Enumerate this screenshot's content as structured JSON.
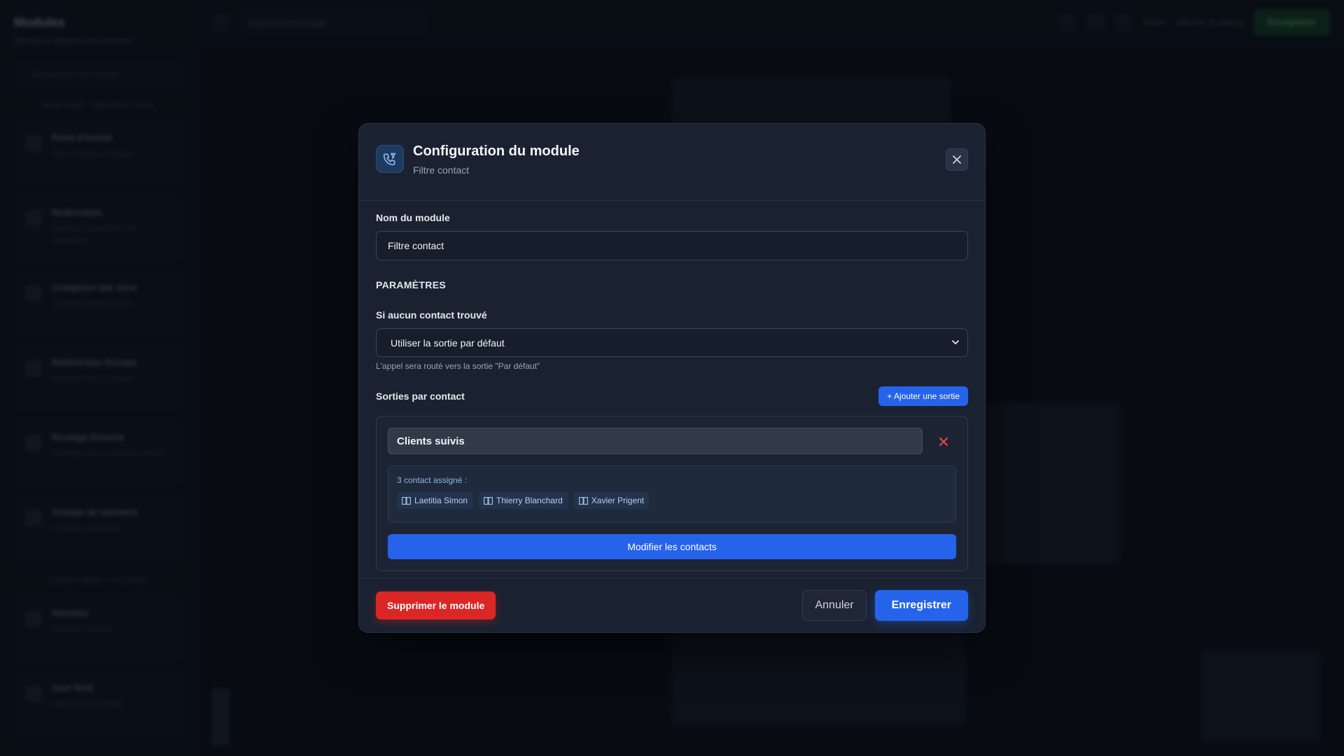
{
  "background": {
    "sidebar": {
      "title": "Modules",
      "subtitle": "Glissez et déposez les modules",
      "search_placeholder": "Rechercher un module",
      "section_routing": "ROUTAGE / REDIRECTION",
      "section_conditions": "CONDITIONS / FILTRES",
      "items": [
        {
          "name": "Point d'entrée",
          "desc": "Point d'entrée de l'appel"
        },
        {
          "name": "Redirection",
          "desc": "Redirige l'appel vers une destination"
        },
        {
          "name": "Composer par zone",
          "desc": "Compose selon la zone"
        },
        {
          "name": "Redirection Groupe",
          "desc": "Redirige vers un groupe"
        },
        {
          "name": "Routage Externe",
          "desc": "Routage vers un numéro externe"
        },
        {
          "name": "Groupe de sonnerie",
          "desc": "Sonnerie simultanée"
        }
      ],
      "items_conditions": [
        {
          "name": "Horaires",
          "desc": "Selon les horaires"
        },
        {
          "name": "Jour férié",
          "desc": "Selon les jours fériés"
        }
      ]
    },
    "topbar": {
      "input_text": "Ligne commerciale",
      "zoom": "Zoom",
      "debug": "Afficher le debug",
      "save": "Enregistrer"
    }
  },
  "modal": {
    "title": "Configuration du module",
    "subtitle": "Filtre contact",
    "name_label": "Nom du module",
    "name_value": "Filtre contact",
    "params_title": "PARAMÈTRES",
    "no_contact_label": "Si aucun contact trouvé",
    "no_contact_selected": "Utiliser la sortie par défaut",
    "no_contact_hint": "L'appel sera routé vers la sortie \"Par défaut\"",
    "outputs_label": "Sorties par contact",
    "add_output_label": "+ Ajouter une sortie",
    "output": {
      "name": "Clients suivis",
      "assigned_label": "3 contact assigné :",
      "contacts": [
        "Laetitia Simon",
        "Thierry Blanchard",
        "Xavier Prigent"
      ],
      "modify_label": "Modifier les contacts"
    },
    "footer": {
      "delete_label": "Supprimer le module",
      "cancel_label": "Annuler",
      "save_label": "Enregistrer"
    }
  },
  "colors": {
    "primary": "#2563eb",
    "danger": "#dc2626",
    "modal_bg": "#1a2231"
  }
}
